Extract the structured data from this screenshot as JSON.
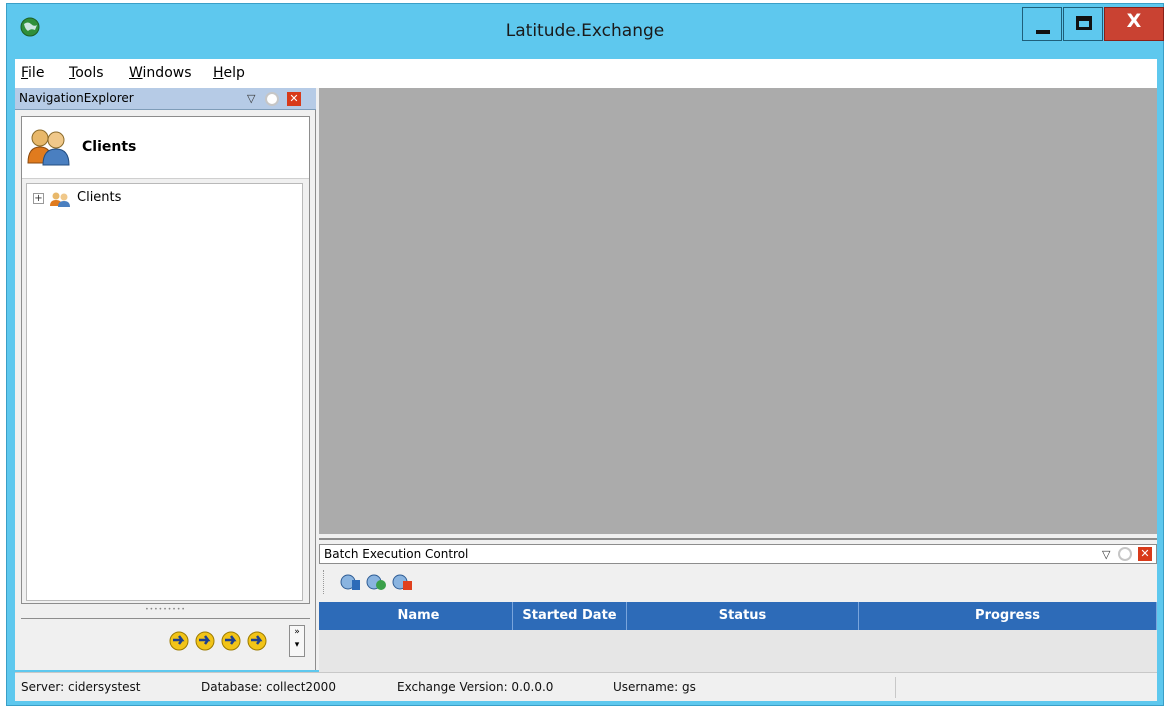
{
  "window": {
    "title": "Latitude.Exchange",
    "close_label": "X"
  },
  "menu": {
    "items": [
      {
        "label": "File",
        "underline": "F",
        "rest": "ile"
      },
      {
        "label": "Tools",
        "underline": "T",
        "rest": "ools"
      },
      {
        "label": "Windows",
        "underline": "W",
        "rest": "indows"
      },
      {
        "label": "Help",
        "underline": "H",
        "rest": "elp"
      }
    ]
  },
  "navigation_explorer": {
    "title": "NavigationExplorer",
    "section_title": "Clients",
    "tree": [
      {
        "label": "Clients",
        "expander": "+"
      }
    ],
    "splitter": "•••••••••",
    "overflow": "»\n▾"
  },
  "batch_execution_control": {
    "title": "Batch Execution Control",
    "columns": [
      "Name",
      "Started Date",
      "Status",
      "Progress"
    ]
  },
  "statusbar": {
    "server": "Server: cidersystest",
    "database": "Database: collect2000",
    "version": "Exchange Version: 0.0.0.0",
    "username": "Username: gs"
  },
  "icons": {
    "app": "globe-icon",
    "minimize": "minimize-icon",
    "maximize": "maximize-icon",
    "close": "close-icon",
    "clients_large": "users-icon",
    "clients_small": "users-icon",
    "nav_buttons": [
      "arrow-right-icon",
      "arrow-right-icon",
      "arrow-right-icon",
      "arrow-right-icon"
    ],
    "batch_toolbar": [
      "batch-start-icon",
      "batch-refresh-icon",
      "batch-stop-icon"
    ]
  },
  "colors": {
    "titlebar": "#5ec8ee",
    "close_button": "#c94232",
    "grid_header": "#2d6bb8",
    "workspace": "#ababab",
    "nav_header": "#b6cbe6"
  }
}
